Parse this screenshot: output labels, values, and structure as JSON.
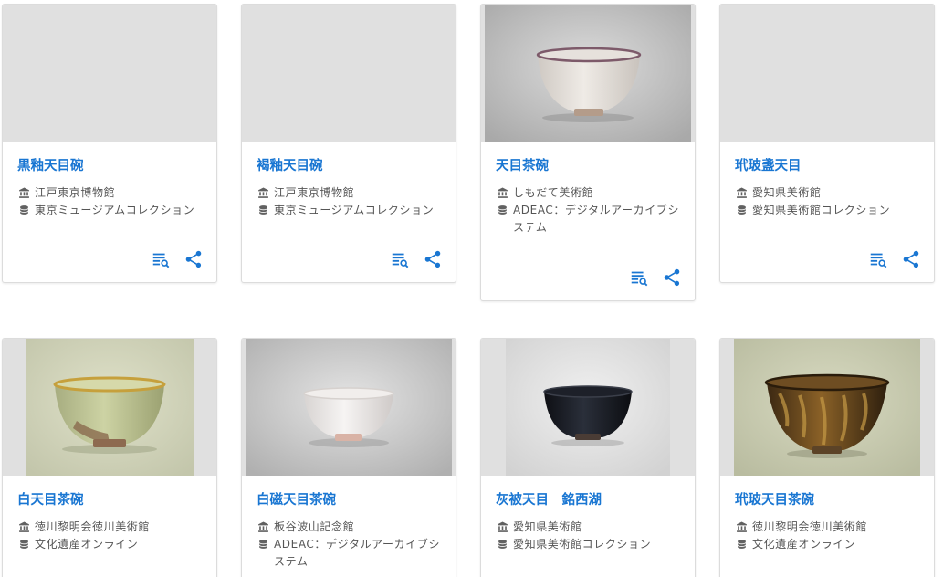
{
  "colors": {
    "link": "#1976d2",
    "placeholder": "#e0e0e0",
    "meta_text": "#555555"
  },
  "icons": {
    "institution": "bank-icon",
    "database": "database-icon",
    "add_to_list": "playlist-search-icon",
    "share": "share-icon"
  },
  "cards": [
    {
      "title": "黒釉天目碗",
      "institution": "江戸東京博物館",
      "database": "東京ミュージアムコレクション"
    },
    {
      "title": "褐釉天目碗",
      "institution": "江戸東京博物館",
      "database": "東京ミュージアムコレクション"
    },
    {
      "title": "天目茶碗",
      "institution": "しもだて美術館",
      "database": "ADEAC：デジタルアーカイブシステム"
    },
    {
      "title": "玳玻盞天目",
      "institution": "愛知県美術館",
      "database": "愛知県美術館コレクション"
    },
    {
      "title": "白天目茶碗",
      "institution": "徳川黎明会徳川美術館",
      "database": "文化遺産オンライン"
    },
    {
      "title": "白磁天目茶碗",
      "institution": "板谷波山記念館",
      "database": "ADEAC：デジタルアーカイブシステム"
    },
    {
      "title": "灰被天目　銘西湖",
      "institution": "愛知県美術館",
      "database": "愛知県美術館コレクション"
    },
    {
      "title": "玳玻天目茶碗",
      "institution": "徳川黎明会徳川美術館",
      "database": "文化遺産オンライン"
    }
  ]
}
